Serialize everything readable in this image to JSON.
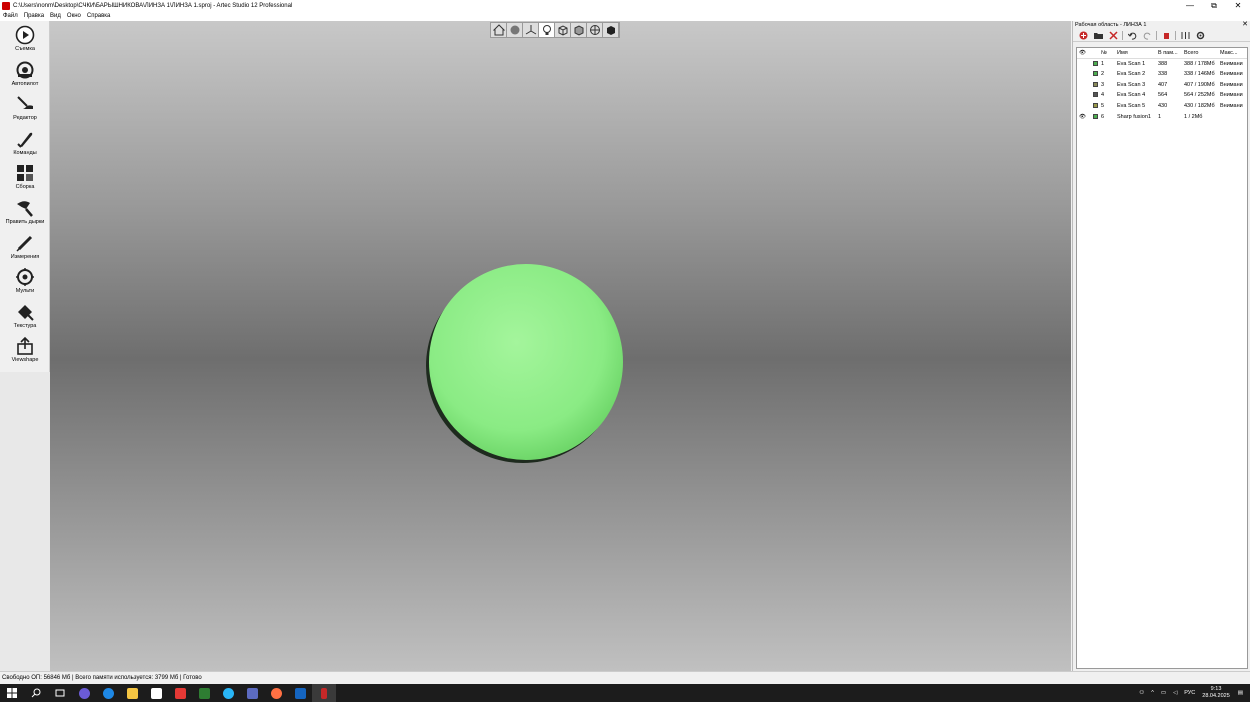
{
  "window": {
    "title": "C:\\Users\\nonm\\Desktop\\СЧКИ\\БАРЫШНИКОВА\\ЛИНЗА 1\\ЛИНЗА 1.sproj - Artec Studio 12 Professional",
    "minimize": "—",
    "restore": "⧉",
    "close": "✕"
  },
  "menu": [
    "Файл",
    "Правка",
    "Вид",
    "Окно",
    "Справка"
  ],
  "toolbar": [
    {
      "label": "Съемка",
      "icon": "play-icon"
    },
    {
      "label": "Автопилот",
      "icon": "autopilot-icon"
    },
    {
      "label": "Редактор",
      "icon": "eraser-tool-icon"
    },
    {
      "label": "Команды",
      "icon": "brush-icon"
    },
    {
      "label": "Сборка",
      "icon": "assembly-icon"
    },
    {
      "label": "Править дырки",
      "icon": "hole-fix-icon"
    },
    {
      "label": "Измерения",
      "icon": "measure-icon"
    },
    {
      "label": "Мульти",
      "icon": "multi-icon"
    },
    {
      "label": "Текстура",
      "icon": "texture-icon"
    },
    {
      "label": "Viewshape",
      "icon": "upload-icon"
    }
  ],
  "panel": {
    "title": "Рабочая область - ЛИНЗА 1",
    "close": "✕",
    "columns": [
      "№",
      "Имя",
      "В пам...",
      "Всего",
      "Макс..."
    ],
    "rows": [
      {
        "num": "1",
        "name": "Eva Scan 1",
        "mem": "388",
        "total": "388 / 178Мб",
        "max": "Внимани",
        "visible": "",
        "color": "#4caf50"
      },
      {
        "num": "2",
        "name": "Eva Scan 2",
        "mem": "338",
        "total": "338 / 146Мб",
        "max": "Внимани",
        "visible": "",
        "color": "#4caf50"
      },
      {
        "num": "3",
        "name": "Eva Scan 3",
        "mem": "407",
        "total": "407 / 190Мб",
        "max": "Внимани",
        "visible": "",
        "color": "#8a8a5a"
      },
      {
        "num": "4",
        "name": "Eva Scan 4",
        "mem": "564",
        "total": "564 / 252Мб",
        "max": "Внимани",
        "visible": "",
        "color": "#555555"
      },
      {
        "num": "5",
        "name": "Eva Scan 5",
        "mem": "430",
        "total": "430 / 182Мб",
        "max": "Внимани",
        "visible": "",
        "color": "#9a9a4a"
      },
      {
        "num": "6",
        "name": "Sharp fusion1",
        "mem": "1",
        "total": "1 / 2Мб",
        "max": "",
        "visible": "👁",
        "color": "#4caf50"
      }
    ]
  },
  "statusbar": "Свободно ОП: 56846 Мб  |  Всего памяти используется: 3799 Мб  |   Готово",
  "tray": {
    "lang": "РУС",
    "time": "9:13",
    "date": "28.04.2025"
  },
  "colors": {
    "object_green": "#8ff08a",
    "accent_red": "#c62828"
  }
}
